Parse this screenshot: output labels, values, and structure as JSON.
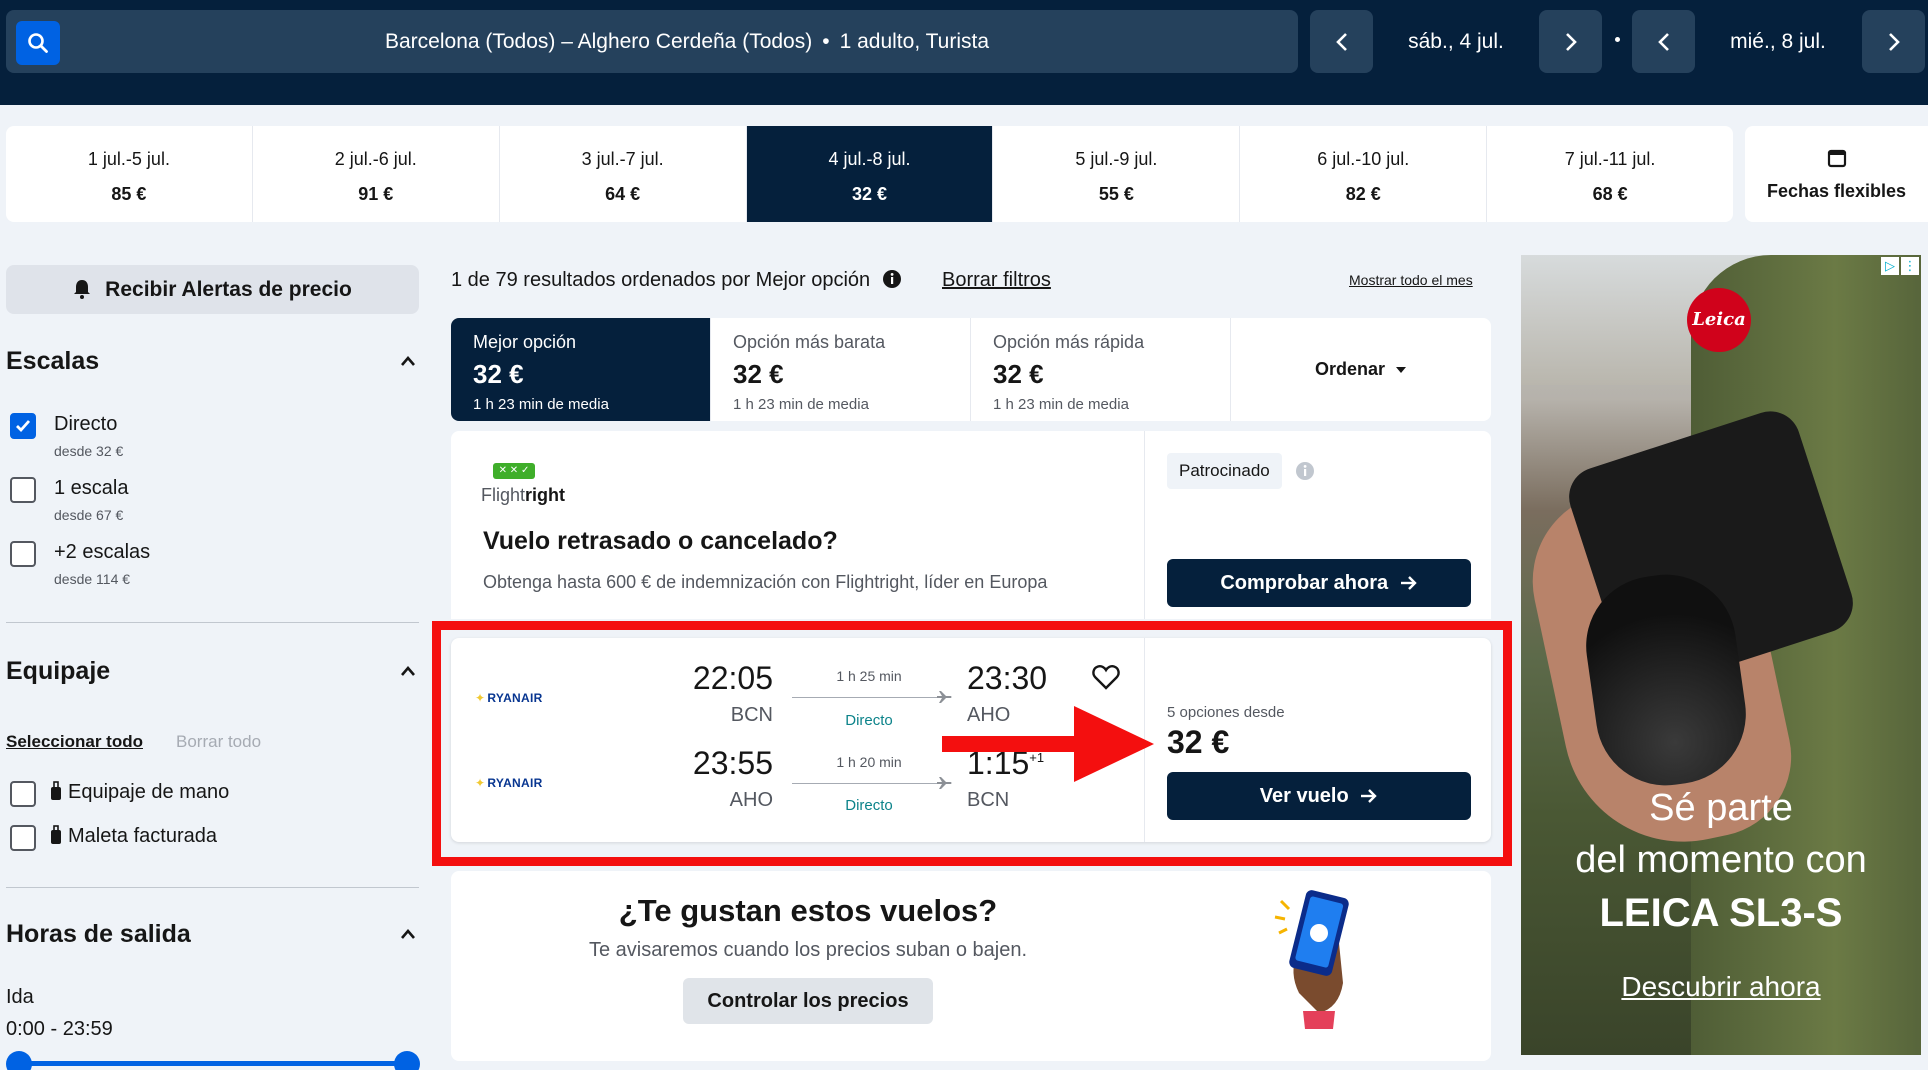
{
  "header": {
    "route": "Barcelona (Todos) – Alghero Cerdeña (Todos)",
    "passengers": "1 adulto, Turista",
    "depart_date": "sáb., 4 jul.",
    "return_date": "mié., 8 jul."
  },
  "date_strip": [
    {
      "range": "1 jul.-5 jul.",
      "price": "85 €"
    },
    {
      "range": "2 jul.-6 jul.",
      "price": "91 €"
    },
    {
      "range": "3 jul.-7 jul.",
      "price": "64 €"
    },
    {
      "range": "4 jul.-8 jul.",
      "price": "32 €"
    },
    {
      "range": "5 jul.-9 jul.",
      "price": "55 €"
    },
    {
      "range": "6 jul.-10 jul.",
      "price": "82 €"
    },
    {
      "range": "7 jul.-11 jul.",
      "price": "68 €"
    }
  ],
  "flexible_dates": "Fechas flexibles",
  "sidebar": {
    "alert_button": "Recibir Alertas de precio",
    "stops": {
      "title": "Escalas",
      "options": [
        {
          "label": "Directo",
          "sub": "desde 32 €",
          "checked": true
        },
        {
          "label": "1 escala",
          "sub": "desde 67 €",
          "checked": false
        },
        {
          "label": "+2 escalas",
          "sub": "desde 114 €",
          "checked": false
        }
      ]
    },
    "baggage": {
      "title": "Equipaje",
      "select_all": "Seleccionar todo",
      "clear_all": "Borrar todo",
      "options": [
        {
          "label": "Equipaje de mano"
        },
        {
          "label": "Maleta facturada"
        }
      ]
    },
    "departure_times": {
      "title": "Horas de salida",
      "leg": "Ida",
      "range": "0:00 - 23:59"
    }
  },
  "results": {
    "count_text": "1 de 79 resultados ordenados por Mejor opción",
    "clear_filters": "Borrar filtros",
    "show_month": "Mostrar todo el mes",
    "tabs": [
      {
        "label": "Mejor opción",
        "price": "32 €",
        "duration": "1 h 23 min de media"
      },
      {
        "label": "Opción más barata",
        "price": "32 €",
        "duration": "1 h 23 min de media"
      },
      {
        "label": "Opción más rápida",
        "price": "32 €",
        "duration": "1 h 23 min de media"
      }
    ],
    "sort_label": "Ordenar"
  },
  "ad_card": {
    "brand_prefix": "Flight",
    "brand_suffix": "right",
    "title": "Vuelo retrasado o cancelado?",
    "description": "Obtenga hasta 600 € de indemnización con Flightright, líder en Europa",
    "sponsored": "Patrocinado",
    "cta": "Comprobar ahora"
  },
  "flight_card": {
    "legs": [
      {
        "airline": "RYANAIR",
        "dep_time": "22:05",
        "dep_airport": "BCN",
        "duration": "1 h 25 min",
        "stops": "Directo",
        "arr_time": "23:30",
        "arr_airport": "AHO",
        "day_offset": ""
      },
      {
        "airline": "RYANAIR",
        "dep_time": "23:55",
        "dep_airport": "AHO",
        "duration": "1 h 20 min",
        "stops": "Directo",
        "arr_time": "1:15",
        "arr_airport": "BCN",
        "day_offset": "+1"
      }
    ],
    "options_text": "5 opciones desde",
    "price": "32 €",
    "cta": "Ver vuelo"
  },
  "promo": {
    "title": "¿Te gustan estos vuelos?",
    "subtitle": "Te avisaremos cuando los precios suban o bajen.",
    "button": "Controlar los precios"
  },
  "right_ad": {
    "brand": "Leica",
    "line1": "Sé parte",
    "line2": "del momento con",
    "line3": "LEICA SL3-S",
    "cta": "Descubrir ahora"
  },
  "colors": {
    "navy": "#05203c",
    "blue": "#0062e3",
    "highlight_red": "#f40f0f",
    "direct_teal": "#0c838a"
  }
}
